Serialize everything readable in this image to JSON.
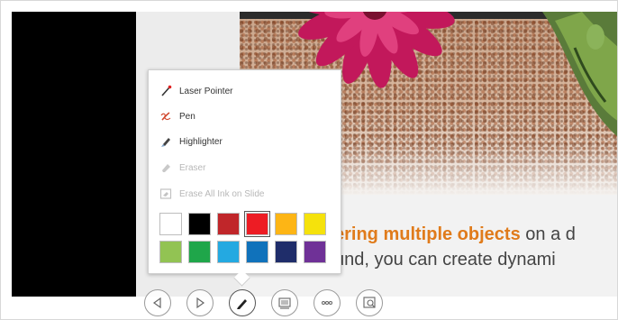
{
  "pen_menu": {
    "items": [
      {
        "label": "Laser Pointer",
        "icon": "laser-pointer-icon",
        "enabled": true
      },
      {
        "label": "Pen",
        "icon": "pen-icon",
        "enabled": true
      },
      {
        "label": "Highlighter",
        "icon": "highlighter-icon",
        "enabled": true
      },
      {
        "label": "Eraser",
        "icon": "eraser-icon",
        "enabled": false
      },
      {
        "label": "Erase All Ink on Slide",
        "icon": "erase-all-icon",
        "enabled": false
      }
    ],
    "colors": [
      "#ffffff",
      "#000000",
      "#c0262a",
      "#ed1c24",
      "#fdb515",
      "#f5e20c",
      "#92c353",
      "#1fa64a",
      "#24a9e1",
      "#1072bb",
      "#1f2d6a",
      "#6f3197"
    ],
    "selected_color": "#ed1c24"
  },
  "slide": {
    "caption_line1_highlight": "ering multiple objects",
    "caption_line1_rest": " on a d",
    "caption_line2": "und, you can create dynami"
  },
  "toolbar": {
    "buttons": [
      "previous-slide-icon",
      "next-slide-icon",
      "pen-tools-icon",
      "see-all-slides-icon",
      "more-options-icon",
      "zoom-icon"
    ]
  }
}
